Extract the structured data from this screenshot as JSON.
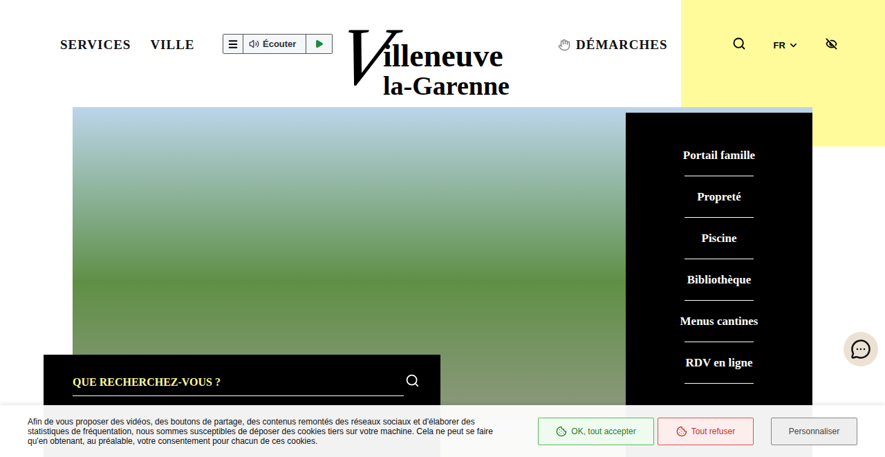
{
  "header": {
    "nav": [
      {
        "label": "SERVICES"
      },
      {
        "label": "VILLE"
      }
    ],
    "listen": {
      "label": "Écouter"
    },
    "logo": {
      "initial": "V",
      "line1": "illeneuve",
      "line2": "la-Garenne"
    },
    "demarches": "DÉMARCHES",
    "language": "FR"
  },
  "quick_links": [
    {
      "label": "Portail famille"
    },
    {
      "label": "Propreté"
    },
    {
      "label": "Piscine"
    },
    {
      "label": "Bibliothèque"
    },
    {
      "label": "Menus cantines"
    },
    {
      "label": "RDV en ligne"
    }
  ],
  "search": {
    "placeholder": "QUE RECHERCHEZ-VOUS ?"
  },
  "cookie_banner": {
    "text": "Afin de vous proposer des vidéos, des boutons de partage, des contenus remontés des réseaux sociaux et d'élaborer des statistiques de fréquentation, nous sommes susceptibles de déposer des cookies tiers sur votre machine. Cela ne peut se faire qu'en obtenant, au préalable, votre consentement pour chacun de ces cookies.",
    "buttons": [
      {
        "label": "OK, tout accepter",
        "kind": "accept"
      },
      {
        "label": "Tout refuser",
        "kind": "refuse"
      },
      {
        "label": "Personnaliser",
        "kind": "customize"
      }
    ]
  }
}
